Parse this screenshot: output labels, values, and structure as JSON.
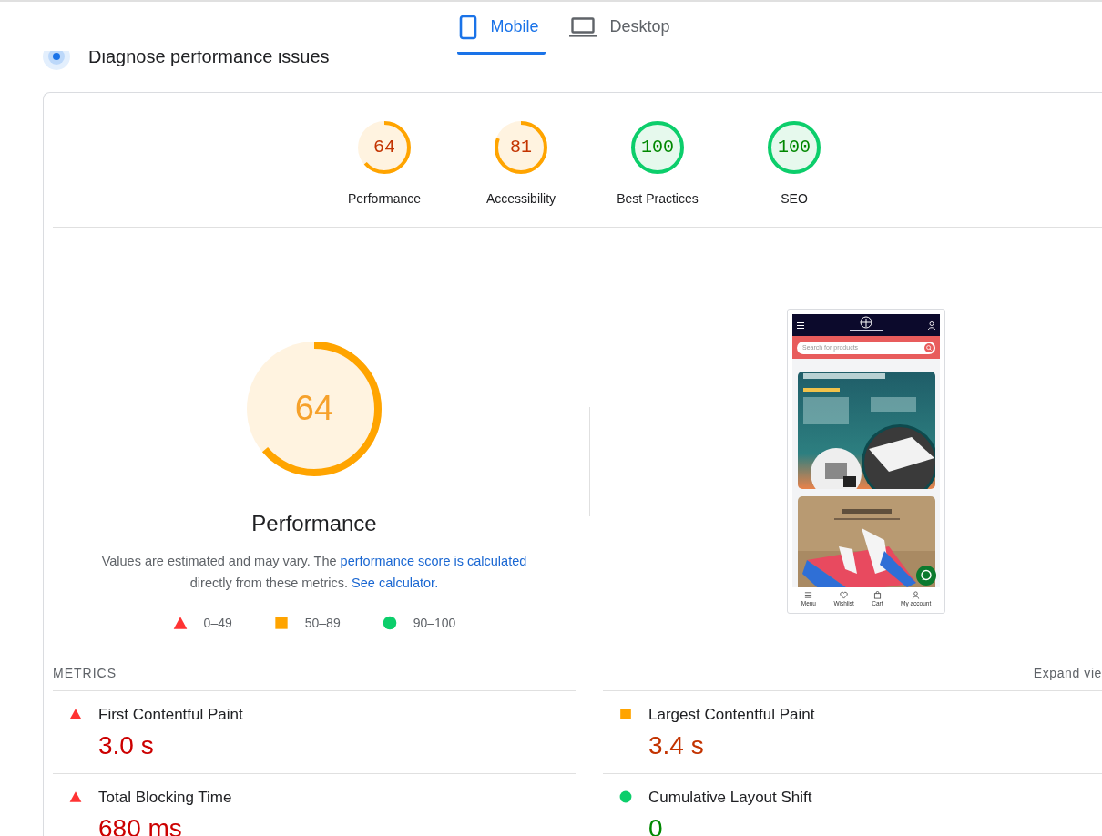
{
  "tabs": [
    {
      "label": "Mobile",
      "kind": "mobile",
      "selected": true
    },
    {
      "label": "Desktop",
      "kind": "desktop",
      "selected": false
    }
  ],
  "section_title": "Diagnose performance issues",
  "categories": [
    {
      "score": "64",
      "label": "Performance",
      "level": 0.64,
      "kind": "average"
    },
    {
      "score": "81",
      "label": "Accessibility",
      "level": 0.81,
      "kind": "average"
    },
    {
      "score": "100",
      "label": "Best Practices",
      "level": 1,
      "kind": "pass"
    },
    {
      "score": "100",
      "label": "SEO",
      "level": 1,
      "kind": "pass"
    }
  ],
  "performance": {
    "score": "64",
    "level": 0.64,
    "kind": "average",
    "title": "Performance",
    "description": [
      {
        "text": "Values are estimated and may vary. The "
      },
      {
        "link": "performance score is calculated"
      },
      {
        "text": " directly from these metrics. "
      },
      {
        "link": "See calculator."
      }
    ],
    "legend": [
      {
        "kind": "fail",
        "range": "0–49"
      },
      {
        "kind": "average",
        "range": "50–89"
      },
      {
        "kind": "pass",
        "range": "90–100"
      }
    ]
  },
  "screenshot": {
    "search_placeholder": "Search for products",
    "nav": [
      {
        "label": "Menu",
        "kind": "menu"
      },
      {
        "label": "Wishlist",
        "kind": "heart"
      },
      {
        "label": "Cart",
        "kind": "bag"
      },
      {
        "label": "My account",
        "kind": "user"
      }
    ]
  },
  "metrics": {
    "title": "METRICS",
    "toggle": "Expand vie",
    "items": [
      {
        "name": "First Contentful Paint",
        "value": "3.0 s",
        "kind": "fail"
      },
      {
        "name": "Largest Contentful Paint",
        "value": "3.4 s",
        "kind": "average"
      },
      {
        "name": "Total Blocking Time",
        "value": "680 ms",
        "kind": "fail"
      },
      {
        "name": "Cumulative Layout Shift",
        "value": "0",
        "kind": "pass"
      }
    ]
  }
}
